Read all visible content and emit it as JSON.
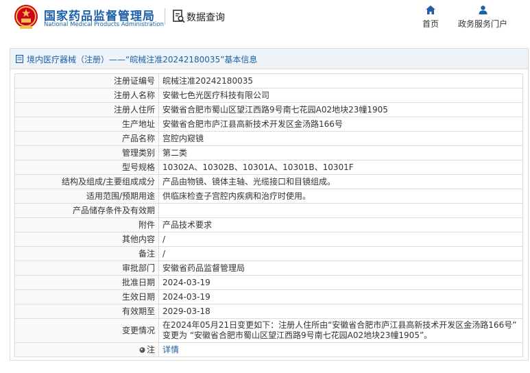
{
  "header": {
    "org_name_cn": "国家药品监督管理局",
    "org_name_en": "National Medical Products Administration",
    "section_title": "数据查询",
    "nav": [
      {
        "label": "首页",
        "icon": "home-icon"
      },
      {
        "label": "政务服务门户",
        "icon": "user-icon"
      }
    ]
  },
  "panel": {
    "title": "境内医疗器械（注册）——“皖械注准20242180035”基本信息"
  },
  "record": [
    {
      "label": "注册证编号",
      "value": "皖械注准20242180035"
    },
    {
      "label": "注册人名称",
      "value": "安徽七色光医疗科技有限公司"
    },
    {
      "label": "注册人住所",
      "value": "安徽省合肥市蜀山区望江西路9号南七花园A02地块23幢1905"
    },
    {
      "label": "生产地址",
      "value": "安徽省合肥市庐江县高新技术开发区金汤路166号"
    },
    {
      "label": "产品名称",
      "value": "宫腔内窥镜"
    },
    {
      "label": "管理类别",
      "value": "第二类"
    },
    {
      "label": "型号规格",
      "value": "10302A、10302B、10301A、10301B、10301F"
    },
    {
      "label": "结构及组成/主要组成成分",
      "value": "产品由物镜、镜体主轴、光缆接口和目镜组成。"
    },
    {
      "label": "适用范围/预期用途",
      "value": "供临床检查子宫腔内疾病和治疗时使用。"
    },
    {
      "label": "产品储存条件及有效期",
      "value": ""
    },
    {
      "label": "附件",
      "value": "产品技术要求"
    },
    {
      "label": "其他内容",
      "value": "/"
    },
    {
      "label": "备注",
      "value": "/"
    },
    {
      "label": "审批部门",
      "value": "安徽省药品监督管理局"
    },
    {
      "label": "批准日期",
      "value": "2024-03-19"
    },
    {
      "label": "生效日期",
      "value": "2024-03-19"
    },
    {
      "label": "有效期至",
      "value": "2029-03-18"
    },
    {
      "label": "变更情况",
      "value": "在2024年05月21日变更如下：注册人住所由“安徽省合肥市庐江县高新技术开发区金汤路166号” 变更为 “安徽省合肥市蜀山区望江西路9号南七花园A02地块23幢1905”。"
    }
  ],
  "note_row": {
    "label": "注",
    "link": "详情",
    "icon": "info-dot-icon"
  },
  "colors": {
    "brand_blue": "#1d5fa8",
    "emblem_red": "#d0021b",
    "emblem_gold": "#f2c14e"
  }
}
